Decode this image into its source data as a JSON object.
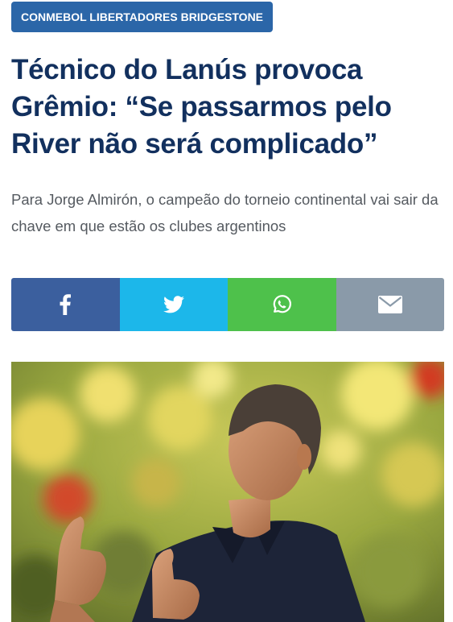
{
  "article": {
    "tag": "CONMEBOL LIBERTADORES BRIDGESTONE",
    "headline": "Técnico do Lanús provoca Grêmio: “Se passarmos pelo River não será complicado”",
    "subtitle": "Para Jorge Almirón, o campeão do torneio continental vai sair da chave em que estão os clubes argentinos"
  },
  "share": {
    "buttons": [
      {
        "network": "facebook",
        "icon": "facebook-icon",
        "color": "#3b5f9e"
      },
      {
        "network": "twitter",
        "icon": "twitter-icon",
        "color": "#1cb7ea"
      },
      {
        "network": "whatsapp",
        "icon": "whatsapp-icon",
        "color": "#4ec14b"
      },
      {
        "network": "email",
        "icon": "email-icon",
        "color": "#8a9aa9"
      }
    ]
  },
  "colors": {
    "tag_background": "#2b66a8",
    "headline": "#12305e",
    "subtitle": "#555a60"
  }
}
